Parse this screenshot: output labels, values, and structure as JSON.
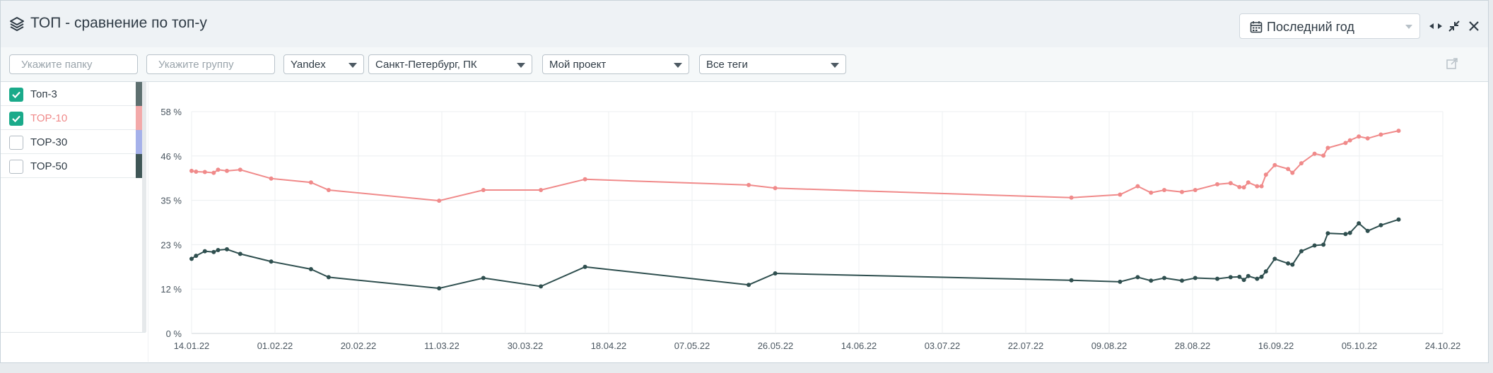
{
  "header": {
    "title": "ТОП - сравнение по топ-у",
    "period": "Последний год"
  },
  "toolbar": {
    "folder_placeholder": "Укажите папку",
    "group_placeholder": "Укажите группу",
    "engine": "Yandex",
    "region": "Санкт-Петербург, ПК",
    "project": "Мой проект",
    "tags": "Все теги"
  },
  "legend": [
    {
      "label": "Топ-3",
      "checked": true,
      "color": "#5e7070",
      "label_color": "#2f3b45"
    },
    {
      "label": "TOP-10",
      "checked": true,
      "color": "#f3a9a9",
      "label_color": "#f08a8a"
    },
    {
      "label": "TOP-30",
      "checked": false,
      "color": "#a5b1ea",
      "label_color": "#2f3b45"
    },
    {
      "label": "TOP-50",
      "checked": false,
      "color": "#3f5656",
      "label_color": "#2f3b45"
    }
  ],
  "chart_data": {
    "type": "line",
    "x_ticks": [
      "14.01.22",
      "01.02.22",
      "20.02.22",
      "11.03.22",
      "30.03.22",
      "18.04.22",
      "07.05.22",
      "26.05.22",
      "14.06.22",
      "03.07.22",
      "22.07.22",
      "09.08.22",
      "28.08.22",
      "16.09.22",
      "05.10.22",
      "24.10.22"
    ],
    "y_ticks": [
      "0 %",
      "12 %",
      "23 %",
      "35 %",
      "46 %",
      "58 %"
    ],
    "ylim": [
      0,
      58
    ],
    "series": [
      {
        "color": "#f08a8a",
        "points": [
          [
            "2022-01-14",
            42.5
          ],
          [
            "2022-01-15",
            42.3
          ],
          [
            "2022-01-17",
            42.2
          ],
          [
            "2022-01-19",
            42.0
          ],
          [
            "2022-01-20",
            42.8
          ],
          [
            "2022-01-22",
            42.5
          ],
          [
            "2022-01-25",
            42.8
          ],
          [
            "2022-02-01",
            40.5
          ],
          [
            "2022-02-10",
            39.5
          ],
          [
            "2022-02-14",
            37.5
          ],
          [
            "2022-03-11",
            34.7
          ],
          [
            "2022-03-21",
            37.5
          ],
          [
            "2022-04-03",
            37.5
          ],
          [
            "2022-04-13",
            40.3
          ],
          [
            "2022-05-20",
            38.8
          ],
          [
            "2022-05-26",
            38.0
          ],
          [
            "2022-08-01",
            35.5
          ],
          [
            "2022-08-12",
            36.3
          ],
          [
            "2022-08-16",
            38.5
          ],
          [
            "2022-08-19",
            36.8
          ],
          [
            "2022-08-22",
            37.5
          ],
          [
            "2022-08-26",
            37.0
          ],
          [
            "2022-08-29",
            37.5
          ],
          [
            "2022-09-03",
            39.0
          ],
          [
            "2022-09-06",
            39.3
          ],
          [
            "2022-09-08",
            38.3
          ],
          [
            "2022-09-09",
            38.2
          ],
          [
            "2022-09-10",
            39.5
          ],
          [
            "2022-09-12",
            38.5
          ],
          [
            "2022-09-13",
            38.5
          ],
          [
            "2022-09-14",
            41.5
          ],
          [
            "2022-09-16",
            44.0
          ],
          [
            "2022-09-19",
            43.0
          ],
          [
            "2022-09-20",
            42.0
          ],
          [
            "2022-09-22",
            44.5
          ],
          [
            "2022-09-25",
            47.0
          ],
          [
            "2022-09-27",
            46.5
          ],
          [
            "2022-09-28",
            48.5
          ],
          [
            "2022-10-02",
            49.8
          ],
          [
            "2022-10-03",
            50.5
          ],
          [
            "2022-10-05",
            51.5
          ],
          [
            "2022-10-07",
            51.0
          ],
          [
            "2022-10-10",
            52.0
          ],
          [
            "2022-10-14",
            53.0
          ]
        ]
      },
      {
        "color": "#2f4f4f",
        "points": [
          [
            "2022-01-14",
            19.5
          ],
          [
            "2022-01-15",
            20.3
          ],
          [
            "2022-01-17",
            21.5
          ],
          [
            "2022-01-19",
            21.3
          ],
          [
            "2022-01-20",
            21.8
          ],
          [
            "2022-01-22",
            22.0
          ],
          [
            "2022-01-25",
            20.8
          ],
          [
            "2022-02-01",
            18.8
          ],
          [
            "2022-02-10",
            16.8
          ],
          [
            "2022-02-14",
            14.7
          ],
          [
            "2022-03-11",
            11.8
          ],
          [
            "2022-03-21",
            14.5
          ],
          [
            "2022-04-03",
            12.3
          ],
          [
            "2022-04-13",
            17.4
          ],
          [
            "2022-05-20",
            12.7
          ],
          [
            "2022-05-26",
            15.7
          ],
          [
            "2022-08-01",
            13.9
          ],
          [
            "2022-08-12",
            13.5
          ],
          [
            "2022-08-16",
            14.7
          ],
          [
            "2022-08-19",
            13.8
          ],
          [
            "2022-08-22",
            14.5
          ],
          [
            "2022-08-26",
            13.8
          ],
          [
            "2022-08-29",
            14.5
          ],
          [
            "2022-09-03",
            14.3
          ],
          [
            "2022-09-06",
            14.7
          ],
          [
            "2022-09-08",
            14.8
          ],
          [
            "2022-09-09",
            14.0
          ],
          [
            "2022-09-10",
            15.0
          ],
          [
            "2022-09-12",
            14.3
          ],
          [
            "2022-09-13",
            14.8
          ],
          [
            "2022-09-14",
            16.2
          ],
          [
            "2022-09-16",
            19.5
          ],
          [
            "2022-09-19",
            18.3
          ],
          [
            "2022-09-20",
            18.0
          ],
          [
            "2022-09-22",
            21.5
          ],
          [
            "2022-09-25",
            23.0
          ],
          [
            "2022-09-27",
            23.2
          ],
          [
            "2022-09-28",
            26.2
          ],
          [
            "2022-10-02",
            26.0
          ],
          [
            "2022-10-03",
            26.3
          ],
          [
            "2022-10-05",
            28.8
          ],
          [
            "2022-10-07",
            26.8
          ],
          [
            "2022-10-10",
            28.3
          ],
          [
            "2022-10-14",
            29.8
          ]
        ]
      }
    ],
    "grid": true
  }
}
